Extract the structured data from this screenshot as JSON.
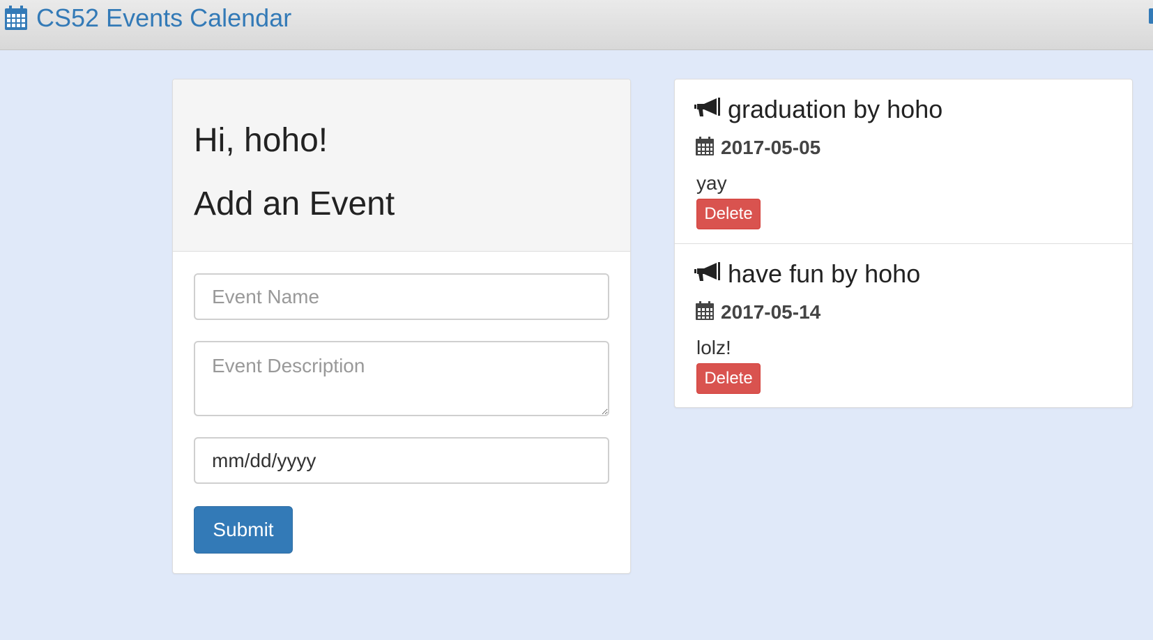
{
  "navbar": {
    "brand_icon": "calendar-icon",
    "brand_text": "CS52 Events Calendar",
    "accent_color": "#337ab7"
  },
  "form_panel": {
    "greeting": "Hi, hoho!",
    "title": "Add an Event",
    "event_name_placeholder": "Event Name",
    "event_description_placeholder": "Event Description",
    "event_date_value": "mm/dd/yyyy",
    "submit_label": "Submit"
  },
  "events": [
    {
      "icon": "megaphone-icon",
      "title": "graduation by hoho",
      "date_icon": "calendar-icon",
      "date": "2017-05-05",
      "description": "yay",
      "delete_label": "Delete"
    },
    {
      "icon": "megaphone-icon",
      "title": "have fun by hoho",
      "date_icon": "calendar-icon",
      "date": "2017-05-14",
      "description": "lolz!",
      "delete_label": "Delete"
    }
  ],
  "colors": {
    "page_background": "#e0e9f9",
    "primary_button": "#337ab7",
    "danger_button": "#d9534f"
  }
}
